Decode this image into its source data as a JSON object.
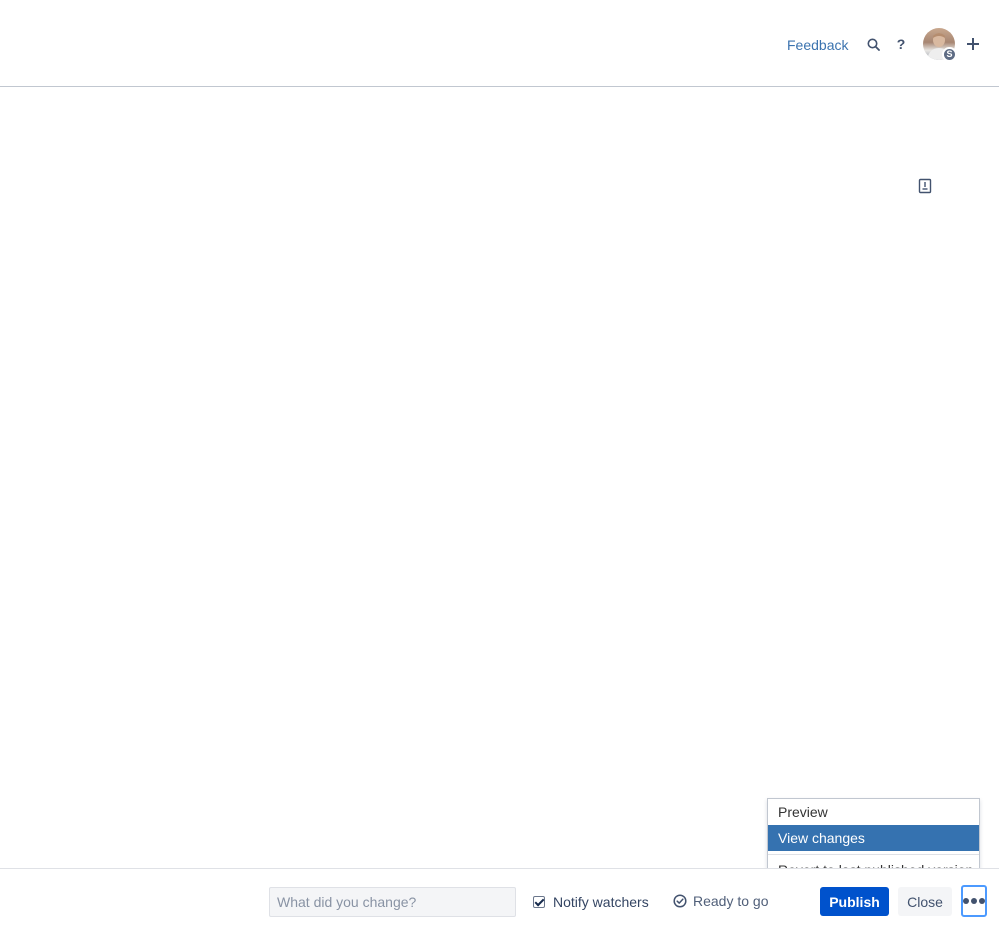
{
  "header": {
    "feedback_label": "Feedback",
    "avatar_badge": "S"
  },
  "icons": {
    "search": "search-icon",
    "help": "question-icon",
    "help_glyph": "?",
    "plus": "plus-icon",
    "plus_glyph": "+",
    "doc": "document-icon",
    "check_circle": "check-circle-icon",
    "more": "ellipsis-icon"
  },
  "dropdown": {
    "items": [
      {
        "label": "Preview"
      },
      {
        "label": "View changes"
      },
      {
        "label": "Revert to last published version"
      }
    ],
    "active_index": 1
  },
  "footer": {
    "comment_placeholder": "What did you change?",
    "comment_value": "",
    "notify_label": "Notify watchers",
    "notify_checked": true,
    "ready_label": "Ready to go",
    "publish_label": "Publish",
    "close_label": "Close"
  },
  "colors": {
    "primary": "#0052cc",
    "link": "#3b73af",
    "menu_active": "#3572b0",
    "focus_ring": "#4c9aff"
  }
}
